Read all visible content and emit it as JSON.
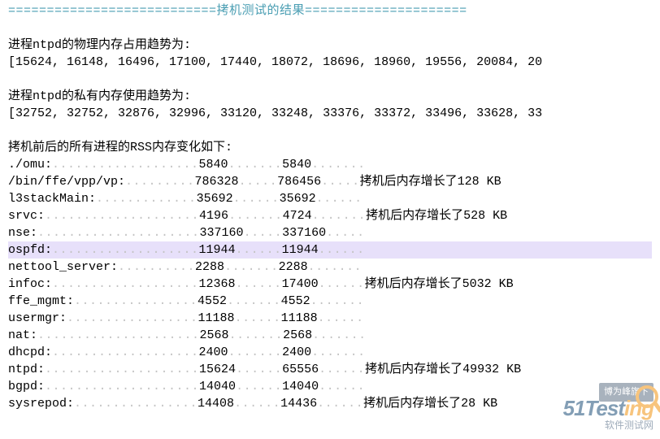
{
  "title_row": "===========================拷机测试的结果=====================",
  "section_phys": "进程ntpd的物理内存占用趋势为:",
  "phys_values": "[15624, 16148, 16496, 17100, 17440, 18072, 18696, 18960, 19556, 20084, 20",
  "section_priv": "进程ntpd的私有内存使用趋势为:",
  "priv_values": "[32752, 32752, 32876, 32996, 33120, 33248, 33376, 33372, 33496, 33628, 33",
  "section_rss": "拷机前后的所有进程的RSS内存变化如下:",
  "note_prefix": "拷机后内存增长了",
  "rows": [
    {
      "name": "./omu:",
      "v1": "5840",
      "v2": "5840",
      "delta": ""
    },
    {
      "name": "/bin/ffe/vpp/vp:",
      "v1": "786328",
      "v2": "786456",
      "delta": "128 KB"
    },
    {
      "name": "l3stackMain:",
      "v1": "35692",
      "v2": "35692",
      "delta": ""
    },
    {
      "name": "srvc:",
      "v1": "4196",
      "v2": "4724",
      "delta": "528 KB"
    },
    {
      "name": "nse:",
      "v1": "337160",
      "v2": "337160",
      "delta": ""
    },
    {
      "name": "ospfd:",
      "v1": "11944",
      "v2": "11944",
      "delta": "",
      "highlight": true
    },
    {
      "name": "nettool_server:",
      "v1": "2288",
      "v2": "2288",
      "delta": ""
    },
    {
      "name": "infoc:",
      "v1": "12368",
      "v2": "17400",
      "delta": "5032 KB"
    },
    {
      "name": "ffe_mgmt:",
      "v1": "4552",
      "v2": "4552",
      "delta": ""
    },
    {
      "name": "usermgr:",
      "v1": "11188",
      "v2": "11188",
      "delta": ""
    },
    {
      "name": "nat:",
      "v1": "2568",
      "v2": "2568",
      "delta": ""
    },
    {
      "name": "dhcpd:",
      "v1": "2400",
      "v2": "2400",
      "delta": ""
    },
    {
      "name": "ntpd:",
      "v1": "15624",
      "v2": "65556",
      "delta": "49932 KB"
    },
    {
      "name": "bgpd:",
      "v1": "14040",
      "v2": "14040",
      "delta": ""
    },
    {
      "name": "sysrepod:",
      "v1": "14408",
      "v2": "14436",
      "delta": "28 KB"
    }
  ],
  "watermark": {
    "top": "博为峰旗下",
    "main_plain": "51Test",
    "main_orange": "ing",
    "sub": "软件测试网"
  }
}
